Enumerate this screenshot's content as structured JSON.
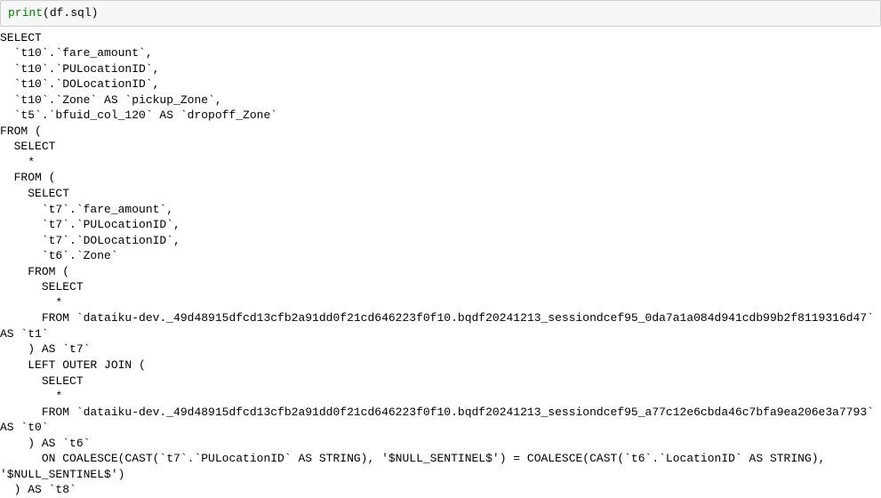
{
  "code": {
    "builtin": "print",
    "open_paren": "(",
    "expr": "df.sql",
    "close_paren": ")"
  },
  "output": "SELECT\n  `t10`.`fare_amount`,\n  `t10`.`PULocationID`,\n  `t10`.`DOLocationID`,\n  `t10`.`Zone` AS `pickup_Zone`,\n  `t5`.`bfuid_col_120` AS `dropoff_Zone`\nFROM (\n  SELECT\n    *\n  FROM (\n    SELECT\n      `t7`.`fare_amount`,\n      `t7`.`PULocationID`,\n      `t7`.`DOLocationID`,\n      `t6`.`Zone`\n    FROM (\n      SELECT\n        *\n      FROM `dataiku-dev._49d48915dfcd13cfb2a91dd0f21cd646223f0f10.bqdf20241213_sessiondcef95_0da7a1a084d941cdb99b2f8119316d47` AS `t1`\n    ) AS `t7`\n    LEFT OUTER JOIN (\n      SELECT\n        *\n      FROM `dataiku-dev._49d48915dfcd13cfb2a91dd0f21cd646223f0f10.bqdf20241213_sessiondcef95_a77c12e6cbda46c7bfa9ea206e3a7793` AS `t0`\n    ) AS `t6`\n      ON COALESCE(CAST(`t7`.`PULocationID` AS STRING), '$NULL_SENTINEL$') = COALESCE(CAST(`t6`.`LocationID` AS STRING), '$NULL_SENTINEL$')\n  ) AS `t8`"
}
